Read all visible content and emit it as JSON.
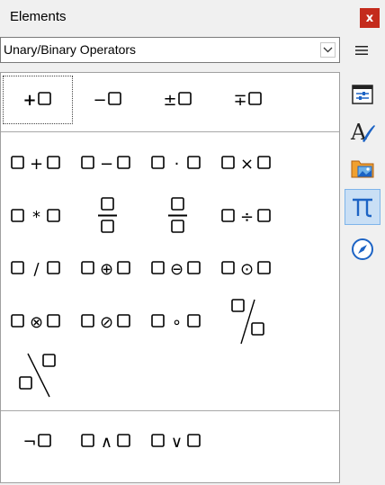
{
  "window": {
    "title": "Elements",
    "close_label": "x"
  },
  "category": {
    "selected": "Unary/Binary Operators"
  },
  "colors": {
    "close": "#c42b1c",
    "accent": "#1c63c4",
    "active_bg": "#c9dff5"
  },
  "sidebar": {
    "items": [
      {
        "name": "properties",
        "icon": "properties-icon",
        "active": false
      },
      {
        "name": "styles",
        "icon": "styles-icon",
        "active": false
      },
      {
        "name": "gallery",
        "icon": "gallery-icon",
        "active": false
      },
      {
        "name": "elements",
        "icon": "pi-icon",
        "active": true
      },
      {
        "name": "navigator",
        "icon": "navigator-icon",
        "active": false
      }
    ]
  },
  "elements": [
    {
      "symbol": "+",
      "kind": "unary",
      "name": "positive-sign"
    },
    {
      "symbol": "−",
      "kind": "unary",
      "name": "negative-sign"
    },
    {
      "symbol": "±",
      "kind": "unary",
      "name": "plus-minus"
    },
    {
      "symbol": "∓",
      "kind": "unary",
      "name": "minus-plus"
    },
    {
      "symbol": "+",
      "kind": "binary",
      "name": "addition"
    },
    {
      "symbol": "−",
      "kind": "binary",
      "name": "subtraction"
    },
    {
      "symbol": "·",
      "kind": "binary",
      "name": "multiplication-dot"
    },
    {
      "symbol": "×",
      "kind": "binary",
      "name": "multiplication-x"
    },
    {
      "symbol": "*",
      "kind": "binary",
      "name": "multiplication-asterisk"
    },
    {
      "symbol": "",
      "kind": "fraction",
      "name": "fraction"
    },
    {
      "symbol": "",
      "kind": "fraction",
      "name": "fraction-wide"
    },
    {
      "symbol": "÷",
      "kind": "binary",
      "name": "division"
    },
    {
      "symbol": "/",
      "kind": "binary",
      "name": "division-slash"
    },
    {
      "symbol": "⊕",
      "kind": "binary",
      "name": "circled-plus"
    },
    {
      "symbol": "⊖",
      "kind": "binary",
      "name": "circled-minus"
    },
    {
      "symbol": "⊙",
      "kind": "binary",
      "name": "circled-dot"
    },
    {
      "symbol": "⊗",
      "kind": "binary",
      "name": "circled-times"
    },
    {
      "symbol": "⊘",
      "kind": "binary",
      "name": "circled-slash"
    },
    {
      "symbol": "∘",
      "kind": "binary",
      "name": "concatenate"
    },
    {
      "symbol": "",
      "kind": "wideslash",
      "name": "wide-slash"
    },
    {
      "symbol": "",
      "kind": "widebslash",
      "name": "wide-backslash"
    },
    {
      "symbol": "¬",
      "kind": "unary",
      "name": "boolean-not"
    },
    {
      "symbol": "∧",
      "kind": "binary",
      "name": "boolean-and"
    },
    {
      "symbol": "∨",
      "kind": "binary",
      "name": "boolean-or"
    }
  ]
}
